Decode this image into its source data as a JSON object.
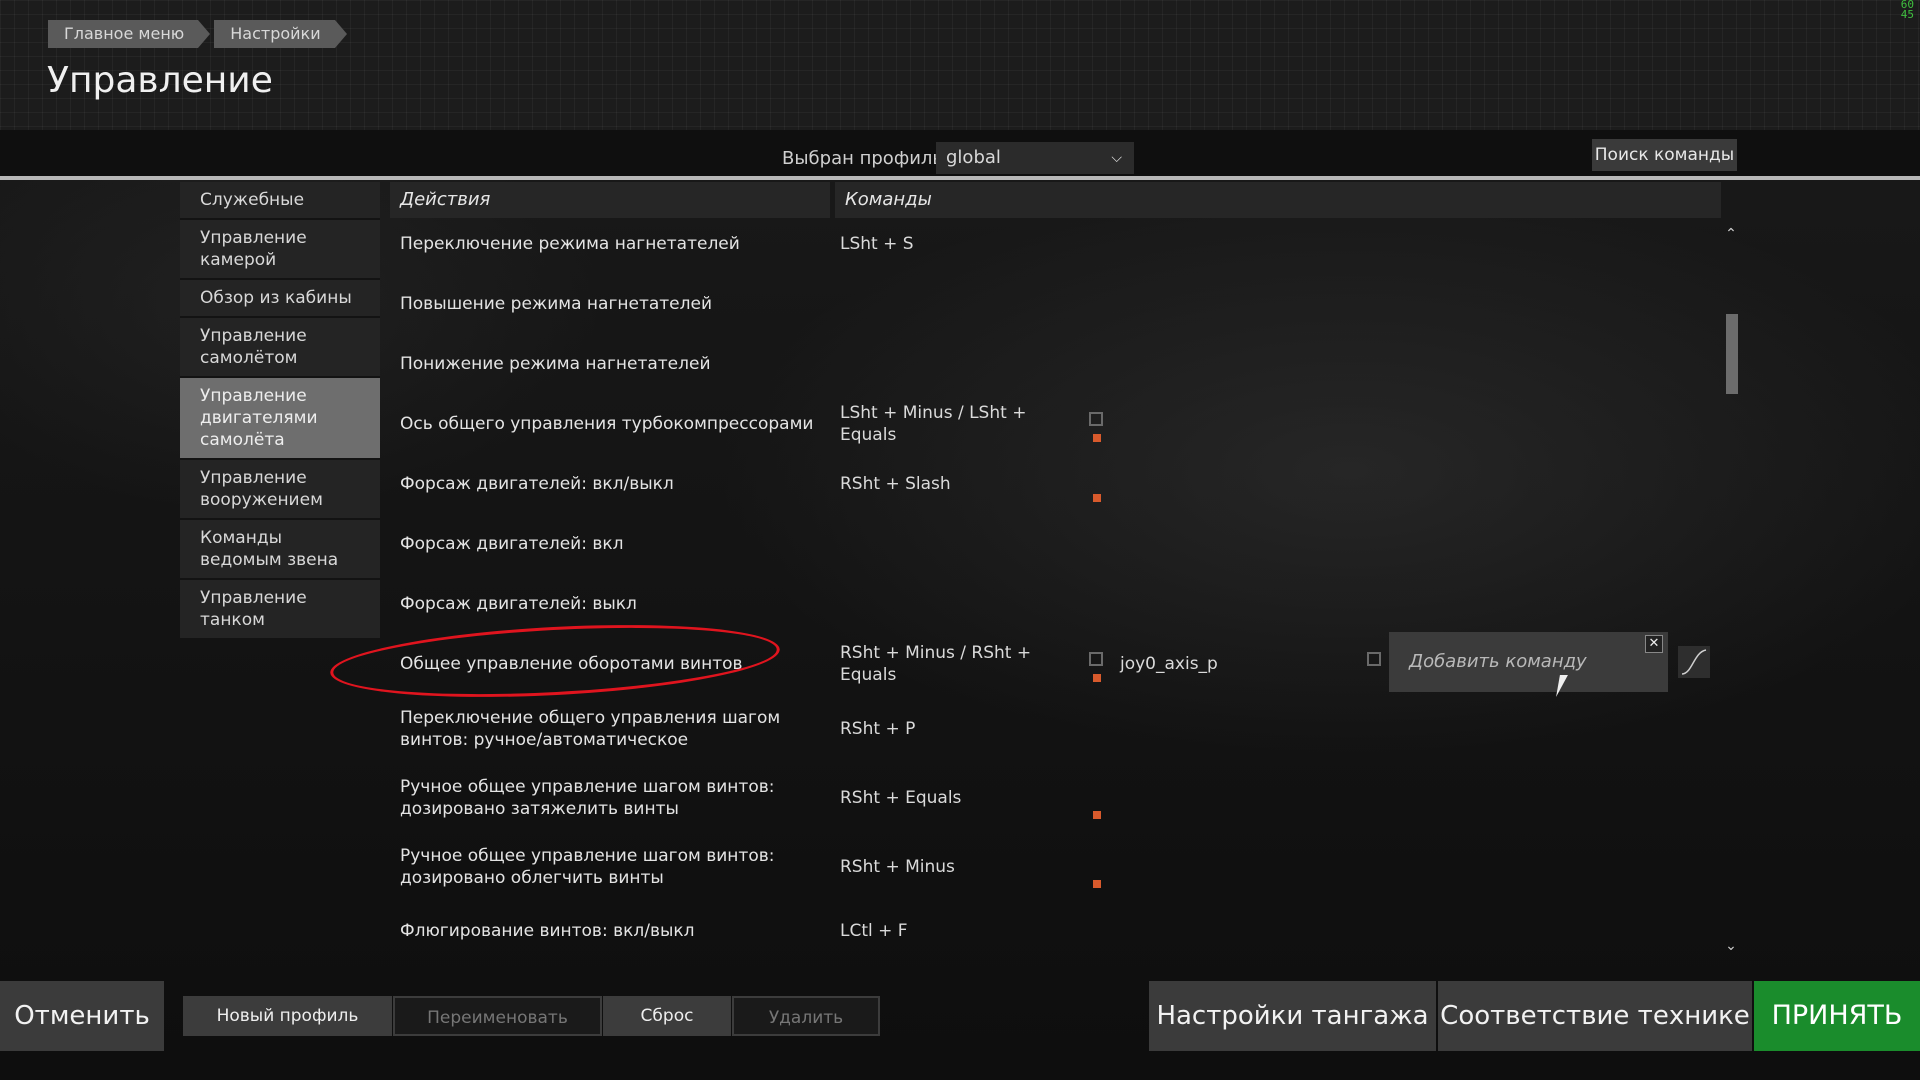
{
  "header": {
    "breadcrumb": [
      "Главное меню",
      "Настройки"
    ],
    "title": "Управление",
    "fps": [
      "60",
      "45"
    ]
  },
  "profile": {
    "label": "Выбран профиль",
    "selected": "global",
    "search_label": "Поиск команды"
  },
  "categories": [
    {
      "label": "Служебные",
      "active": false
    },
    {
      "label": "Управление камерой",
      "active": false
    },
    {
      "label": "Обзор из кабины",
      "active": false
    },
    {
      "label": "Управление самолётом",
      "active": false
    },
    {
      "label": "Управление двигателями самолёта",
      "active": true
    },
    {
      "label": "Управление вооружением",
      "active": false
    },
    {
      "label": "Команды ведомым звена",
      "active": false
    },
    {
      "label": "Управление танком",
      "active": false
    }
  ],
  "table": {
    "col_actions": "Действия",
    "col_commands": "Команды",
    "rows": [
      {
        "action": "Переключение режима нагнетателей",
        "command": "LSht + S"
      },
      {
        "action": "Повышение режима нагнетателей",
        "command": ""
      },
      {
        "action": "Понижение режима нагнетателей",
        "command": ""
      },
      {
        "action": "Ось общего управления турбокомпрессорами",
        "command": "LSht + Minus / LSht + Equals"
      },
      {
        "action": "Форсаж двигателей: вкл/выкл",
        "command": "RSht + Slash"
      },
      {
        "action": "Форсаж двигателей: вкл",
        "command": ""
      },
      {
        "action": "Форсаж двигателей: выкл",
        "command": ""
      },
      {
        "action": "Общее управление оборотами винтов",
        "command": "RSht + Minus / RSht + Equals",
        "axis": "joy0_axis_p",
        "add_command": "Добавить команду"
      },
      {
        "action": "Переключение общего управления шагом винтов: ручное/автоматическое",
        "command": "RSht + P"
      },
      {
        "action": "Ручное общее управление шагом винтов: дозировано затяжелить винты",
        "command": "RSht + Equals"
      },
      {
        "action": "Ручное общее управление шагом винтов: дозировано облегчить винты",
        "command": "RSht + Minus"
      },
      {
        "action": "Флюгирование винтов: вкл/выкл",
        "command": "LCtl + F"
      }
    ]
  },
  "footer": {
    "cancel": "Отменить",
    "new_profile": "Новый профиль",
    "rename": "Переименовать",
    "reset": "Сброс",
    "delete": "Удалить",
    "pitch_settings": "Настройки тангажа",
    "vehicle_match": "Соответствие технике",
    "accept": "ПРИНЯТЬ"
  },
  "colors": {
    "accept": "#1a8c2c",
    "highlight": "#e0141e",
    "binding_dot": "#d85a2c"
  }
}
